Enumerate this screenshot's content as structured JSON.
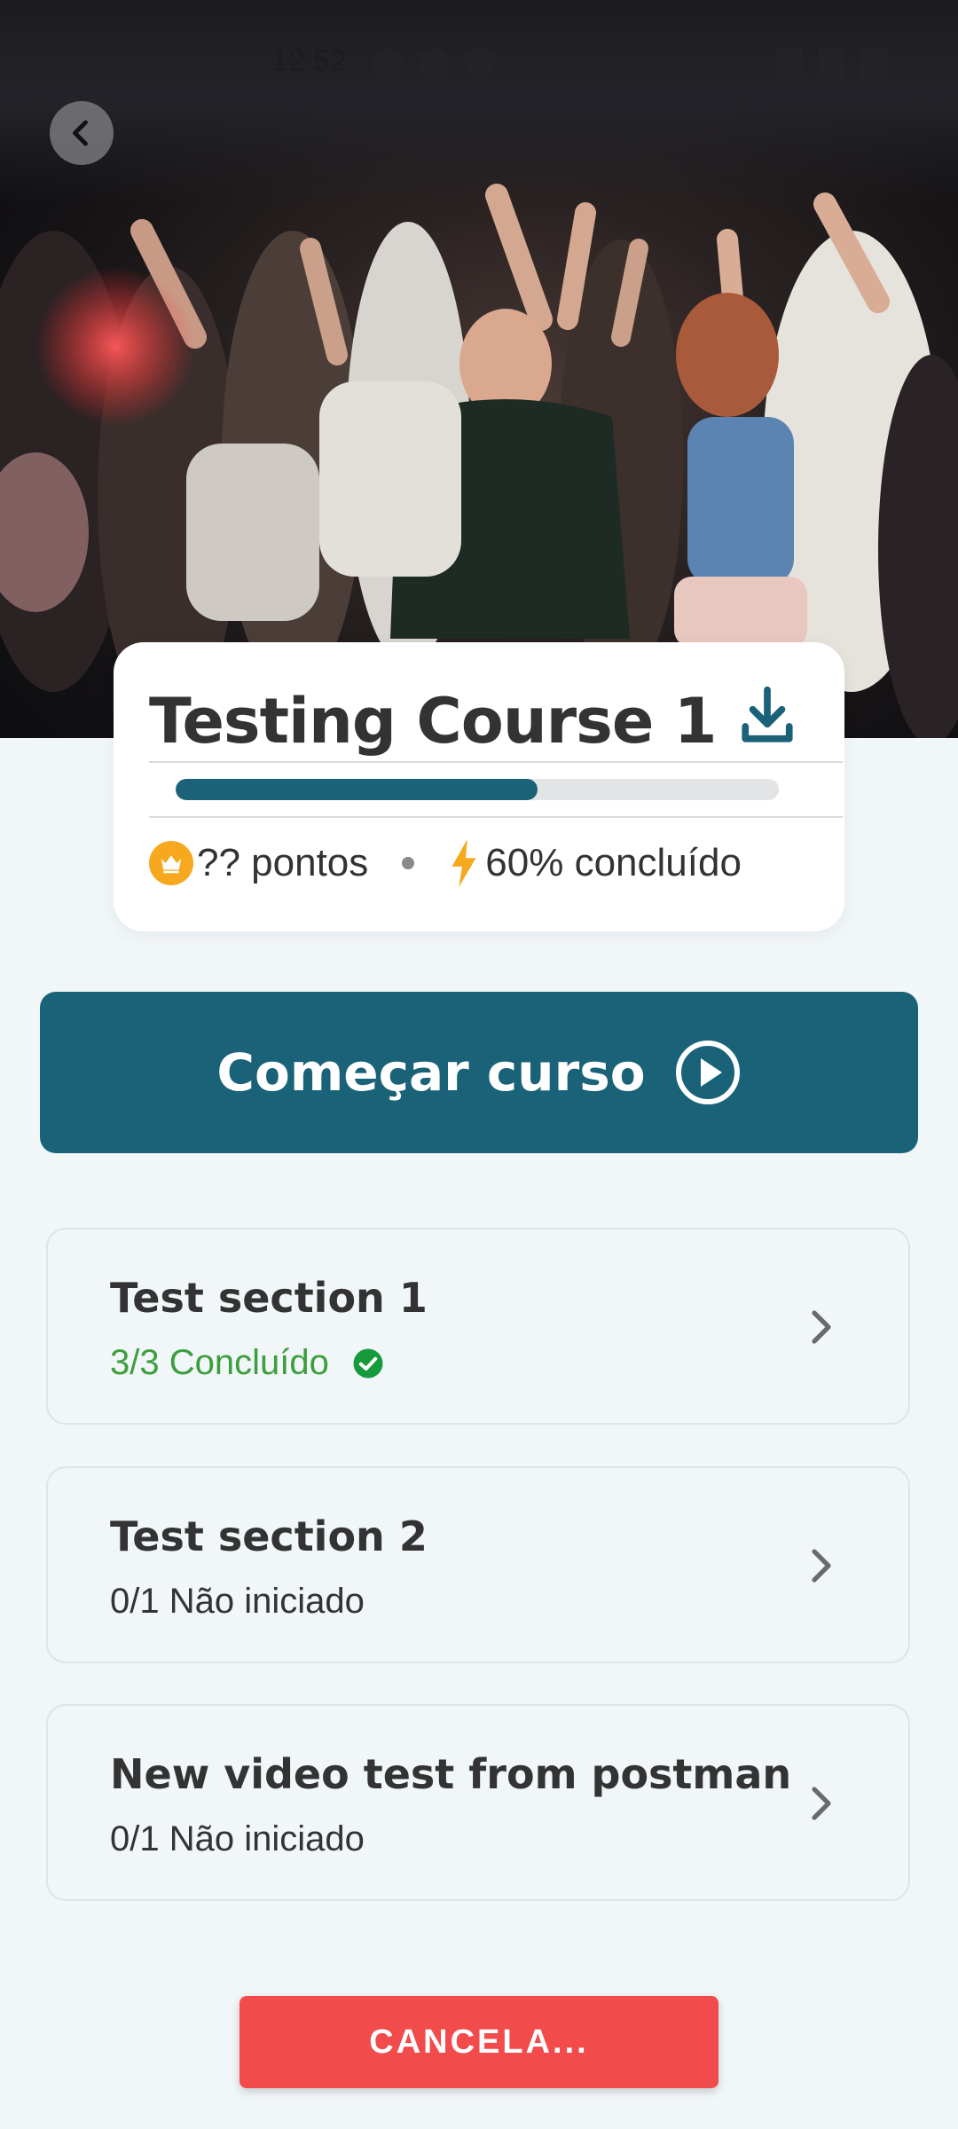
{
  "status_bar": {
    "time": "12:52"
  },
  "hero": {
    "image_icon": "party-crowd-photo",
    "back_icon": "chevron-left-icon"
  },
  "course": {
    "title": "Testing Course 1",
    "download_icon": "download-icon",
    "progress_fraction": 0.6,
    "points_label": "?? pontos",
    "points_icon": "crown-icon",
    "completion_label": "60% concluído",
    "completion_icon": "bolt-icon"
  },
  "start_button": {
    "label": "Começar curso",
    "icon": "play-circle-icon"
  },
  "sections": [
    {
      "title": "Test section 1",
      "status": "3/3 Concluído",
      "completed": true
    },
    {
      "title": "Test section 2",
      "status": "0/1 Não iniciado",
      "completed": false
    },
    {
      "title": "New video test from postman",
      "status": "0/1 Não iniciado",
      "completed": false
    }
  ],
  "cancel_button": {
    "label": "CANCELA..."
  },
  "colors": {
    "primary": "#1a6277",
    "progress_track": "#e3e4e5",
    "success": "#3c9e3c",
    "accent_orange": "#f6a81f",
    "danger": "#f24b4b",
    "background": "#f1f6f9"
  }
}
